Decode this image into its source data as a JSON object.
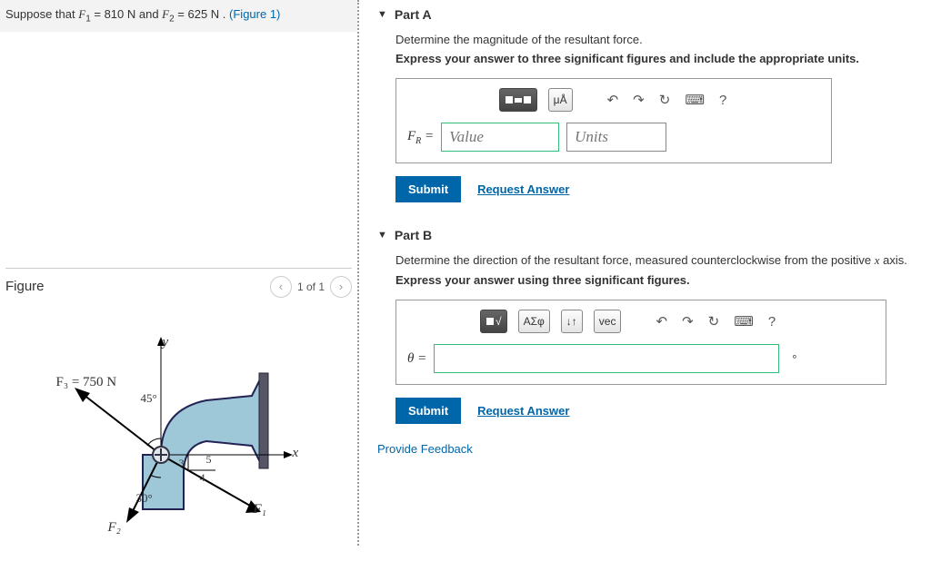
{
  "problem": {
    "prefix": "Suppose that ",
    "F1_sym": "F",
    "F1_idx": "1",
    "F1_val": " = 810  N and ",
    "F2_sym": "F",
    "F2_idx": "2",
    "F2_val": " = 625  N . ",
    "figlink": "(Figure 1)"
  },
  "figure": {
    "title": "Figure",
    "pager": "1 of 1",
    "labels": {
      "y": "y",
      "x": "x",
      "F3": "F₃ = 750 N",
      "a45": "45°",
      "a30": "30°",
      "F2": "F₂",
      "F1": "F₁",
      "d5": "5",
      "d4": "4",
      "d3": "3"
    }
  },
  "partA": {
    "title": "Part A",
    "desc": "Determine the magnitude of the resultant force.",
    "instr": "Express your answer to three significant figures and include the appropriate units.",
    "toolbar": {
      "templates": "",
      "ua": "μÅ",
      "undo": "↶",
      "redo": "↷",
      "reset": "↻",
      "kbd": "⌨",
      "help": "?"
    },
    "label": "F",
    "sub": "R",
    "eq": " = ",
    "value_ph": "Value",
    "units_ph": "Units",
    "submit": "Submit",
    "request": "Request Answer"
  },
  "partB": {
    "title": "Part B",
    "desc_pre": "Determine the direction of the resultant force, measured counterclockwise from the positive ",
    "desc_x": "x",
    "desc_post": " axis.",
    "instr": "Express your answer using three significant figures.",
    "toolbar": {
      "sqrt": "√",
      "greek": "ΑΣφ",
      "sort": "↓↑",
      "vec": "vec",
      "undo": "↶",
      "redo": "↷",
      "reset": "↻",
      "kbd": "⌨",
      "help": "?"
    },
    "label": "θ = ",
    "deg": "°",
    "submit": "Submit",
    "request": "Request Answer"
  },
  "feedback": "Provide Feedback"
}
